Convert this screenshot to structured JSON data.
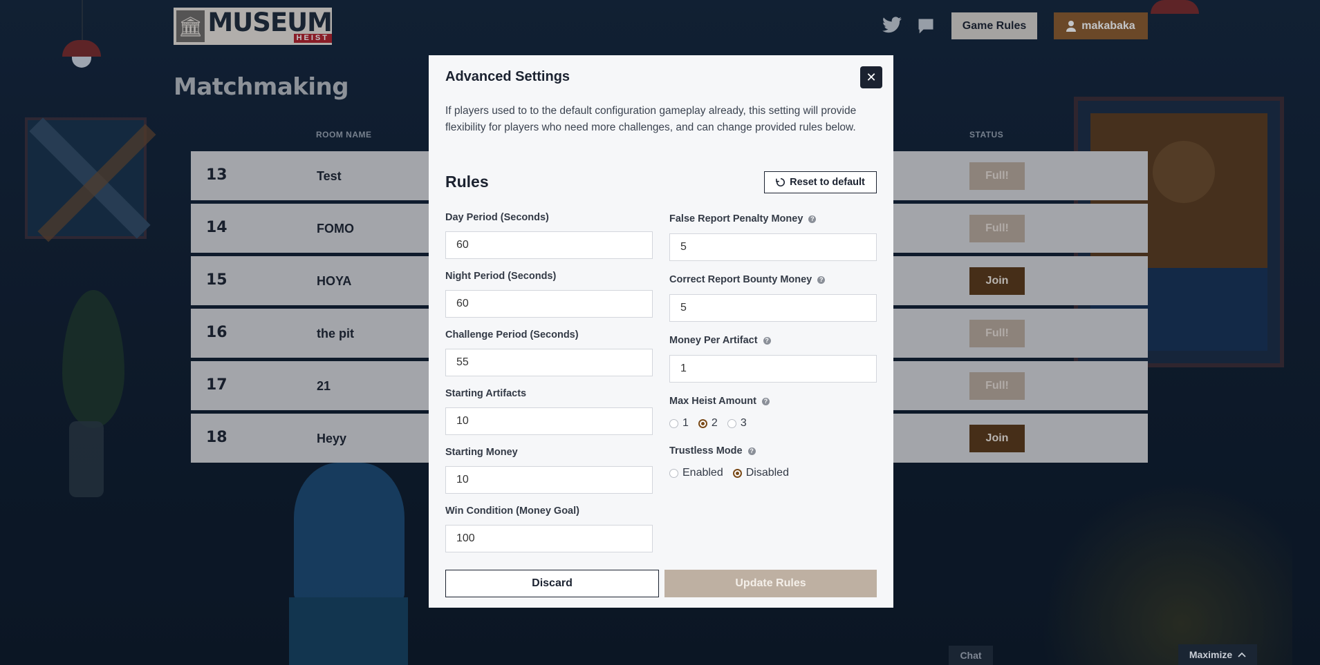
{
  "header": {
    "logo": {
      "title": "MUSEUM",
      "subtitle": "HEIST"
    },
    "game_rules_label": "Game Rules",
    "username": "makabaka"
  },
  "page_title": "Matchmaking",
  "table": {
    "columns": {
      "room_name": "ROOM NAME",
      "status": "STATUS"
    },
    "rows": [
      {
        "id": "13",
        "name": "Test",
        "status": "Full!",
        "joinable": false
      },
      {
        "id": "14",
        "name": "FOMO",
        "status": "Full!",
        "joinable": false
      },
      {
        "id": "15",
        "name": "HOYA",
        "status": "Join",
        "joinable": true
      },
      {
        "id": "16",
        "name": "the pit",
        "status": "Full!",
        "joinable": false
      },
      {
        "id": "17",
        "name": "21",
        "status": "Full!",
        "joinable": false
      },
      {
        "id": "18",
        "name": "Heyy",
        "status": "Join",
        "joinable": true
      }
    ]
  },
  "modal": {
    "title": "Advanced Settings",
    "close_symbol": "✕",
    "description": "If players used to to the default configuration gameplay already, this setting will provide flexibility for players who need more challenges, and can change provided rules below.",
    "rules_heading": "Rules",
    "reset_label": "Reset to default",
    "left_fields": [
      {
        "label": "Day Period (Seconds)",
        "value": "60"
      },
      {
        "label": "Night Period (Seconds)",
        "value": "60"
      },
      {
        "label": "Challenge Period (Seconds)",
        "value": "55"
      },
      {
        "label": "Starting Artifacts",
        "value": "10"
      },
      {
        "label": "Starting Money",
        "value": "10"
      },
      {
        "label": "Win Condition (Money Goal)",
        "value": "100"
      }
    ],
    "right_fields": [
      {
        "label": "False Report Penalty Money",
        "value": "5"
      },
      {
        "label": "Correct Report Bounty Money",
        "value": "5"
      },
      {
        "label": "Money Per Artifact",
        "value": "1"
      }
    ],
    "max_heist": {
      "label": "Max Heist Amount",
      "options": [
        "1",
        "2",
        "3"
      ],
      "selected": "2"
    },
    "trustless": {
      "label": "Trustless Mode",
      "options": [
        "Enabled",
        "Disabled"
      ],
      "selected": "Disabled"
    },
    "help_glyph": "?",
    "discard_label": "Discard",
    "update_label": "Update Rules"
  },
  "footer": {
    "chat_label": "Chat",
    "maximize_label": "Maximize"
  },
  "colors": {
    "accent_brown": "#8b5a2b",
    "join_brown": "#5a3716",
    "full_tan": "#b9a89a",
    "logo_red": "#b3202a"
  }
}
